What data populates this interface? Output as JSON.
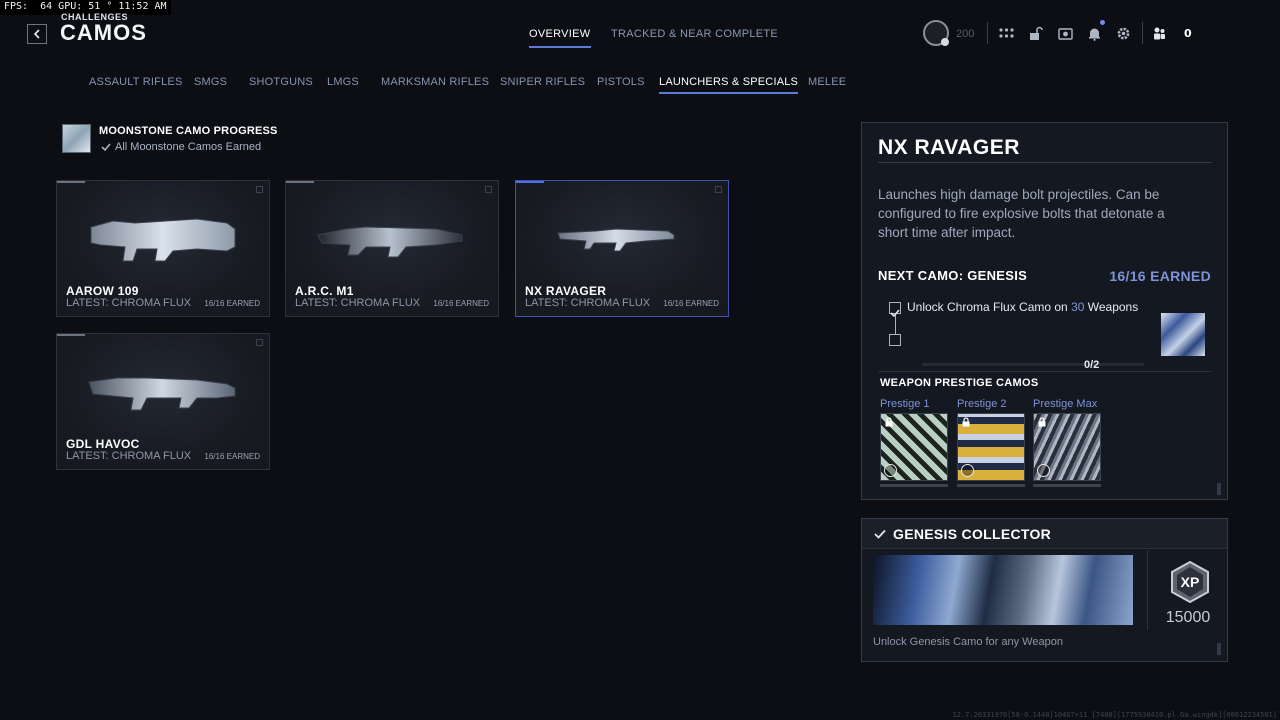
{
  "perf": {
    "fps": "FPS:  64",
    "gpu": "GPU: 51 °",
    "time": "11:52 AM"
  },
  "header": {
    "breadcrumb": "CHALLENGES",
    "title": "CAMOS",
    "tabs": [
      {
        "label": "OVERVIEW",
        "active": true
      },
      {
        "label": "TRACKED & NEAR COMPLETE",
        "active": false
      }
    ],
    "rank_value": "200",
    "friends_count": "0",
    "icons": [
      "rank-badge-icon",
      "grid-icon",
      "lock-open-icon",
      "camera-icon",
      "bell-icon",
      "gear-icon",
      "friends-icon"
    ]
  },
  "categories": [
    {
      "label": "ASSAULT RIFLES"
    },
    {
      "label": "SMGS"
    },
    {
      "label": "SHOTGUNS"
    },
    {
      "label": "LMGS"
    },
    {
      "label": "MARKSMAN RIFLES"
    },
    {
      "label": "SNIPER RIFLES"
    },
    {
      "label": "PISTOLS"
    },
    {
      "label": "LAUNCHERS & SPECIALS",
      "active": true
    },
    {
      "label": "MELEE"
    }
  ],
  "moonstone": {
    "title": "MOONSTONE CAMO PROGRESS",
    "status": "All Moonstone Camos Earned"
  },
  "weapons": [
    {
      "name": "AAROW 109",
      "latest": "LATEST: CHROMA FLUX",
      "earned": "16/16 EARNED"
    },
    {
      "name": "A.R.C. M1",
      "latest": "LATEST: CHROMA FLUX",
      "earned": "16/16 EARNED"
    },
    {
      "name": "NX RAVAGER",
      "latest": "LATEST: CHROMA FLUX",
      "earned": "16/16 EARNED",
      "selected": true
    },
    {
      "name": "GDL HAVOC",
      "latest": "LATEST: CHROMA FLUX",
      "earned": "16/16 EARNED"
    }
  ],
  "detail": {
    "title": "NX RAVAGER",
    "description": "Launches high damage bolt projectiles. Can be configured to fire explosive bolts that detonate a short time after impact.",
    "next_camo": "NEXT CAMO: GENESIS",
    "earned": "16/16 EARNED",
    "task_prefix": "Unlock Chroma Flux Camo on ",
    "task_count": "30",
    "task_suffix": " Weapons",
    "progress": "0/2",
    "prestige_heading": "WEAPON PRESTIGE CAMOS",
    "prestige": [
      {
        "label": "Prestige 1"
      },
      {
        "label": "Prestige 2"
      },
      {
        "label": "Prestige Max"
      }
    ]
  },
  "collector": {
    "title": "GENESIS COLLECTOR",
    "xp_label": "XP",
    "xp_amount": "15000",
    "description": "Unlock Genesis Camo for any Weapon"
  },
  "build_string": "12.7.26331976[58-0.1448]10407+11 [7400][1775930410.pl.Ga.wingdk][00012234501]",
  "colors": {
    "accent": "#5a7bd8",
    "accent_text": "#7d93d6",
    "selected_border": "#3856b0",
    "panel_bg": "#141820"
  }
}
